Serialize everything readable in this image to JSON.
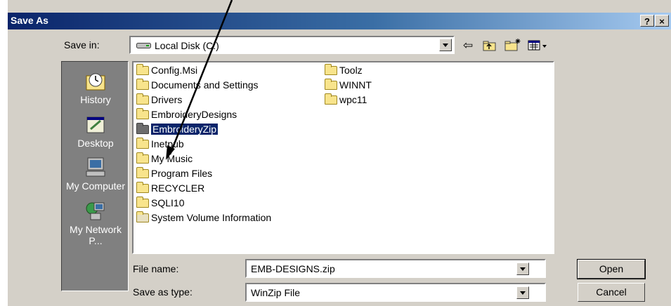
{
  "window": {
    "title": "Save As",
    "help_label": "?",
    "close_label": "×"
  },
  "save_in": {
    "label": "Save in:",
    "value": "Local Disk (C:)"
  },
  "places": [
    "History",
    "Desktop",
    "My Computer",
    "My Network P..."
  ],
  "files": {
    "col1": [
      "Config.Msi",
      "Documents and Settings",
      "Drivers",
      "EmbroideryDesigns",
      "EmbroideryZip",
      "Inetpub",
      "My Music",
      "Program Files",
      "RECYCLER",
      "SQLI10",
      "System Volume Information"
    ],
    "col2": [
      "Toolz",
      "WINNT",
      "wpc11"
    ],
    "selected": "EmbroideryZip"
  },
  "file_name": {
    "label": "File name:",
    "value": "EMB-DESIGNS.zip"
  },
  "save_as_type": {
    "label": "Save as type:",
    "value": "WinZip File"
  },
  "buttons": {
    "open": "Open",
    "cancel": "Cancel"
  },
  "toolbar_icons": [
    "back-icon",
    "up-folder-icon",
    "new-folder-icon",
    "view-menu-icon"
  ]
}
